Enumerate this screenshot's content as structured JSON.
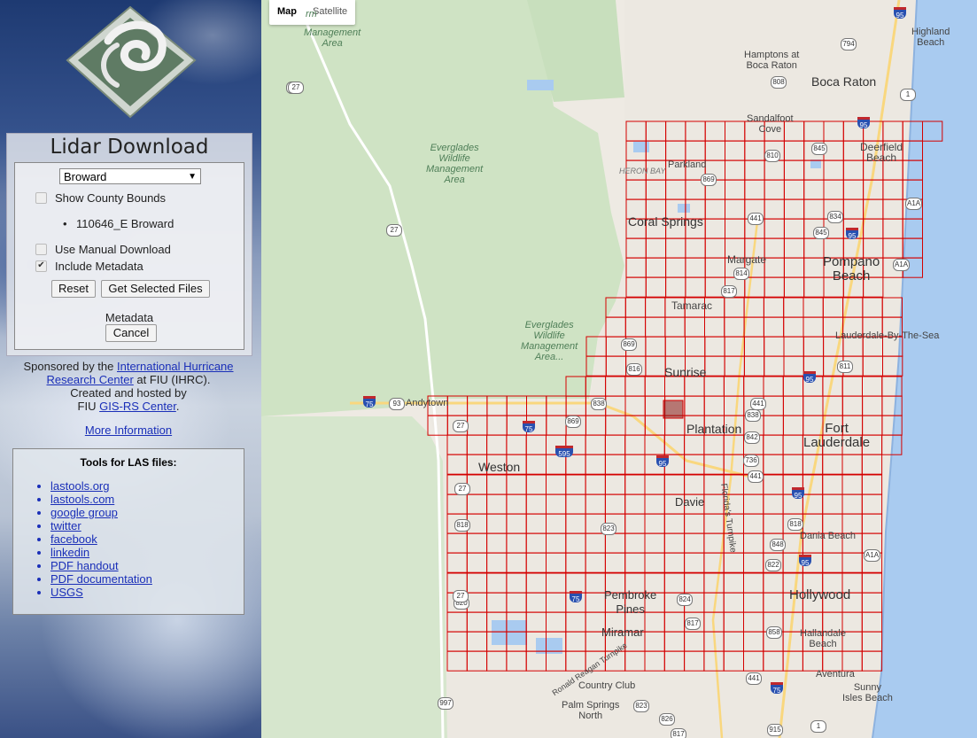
{
  "sidebar": {
    "title": "Lidar Download",
    "county_select": "Broward",
    "show_county_bounds": "Show County Bounds",
    "selected_tile": "110646_E Broward",
    "use_manual_download": "Use Manual Download",
    "include_metadata": "Include Metadata",
    "reset_label": "Reset",
    "get_files_label": "Get Selected Files",
    "metadata_label": "Metadata",
    "cancel_label": "Cancel",
    "sponsor": {
      "prefix": "Sponsored by the ",
      "ihrc_link": "International Hurricane Research Center",
      "mid": " at FIU (IHRC).",
      "created": "Created and hosted by",
      "fiu": "FIU ",
      "gis_link": "GIS-RS Center",
      "end": "."
    },
    "more_info": "More Information",
    "tools_title": "Tools for LAS files:",
    "tools": [
      "lastools.org",
      "lastools.com",
      "google group",
      "twitter",
      "facebook",
      "linkedin",
      "PDF handout",
      "PDF documentation",
      "USGS"
    ]
  },
  "map": {
    "toggle": {
      "map": "Map",
      "satellite": "Satellite"
    },
    "areas": {
      "wma_top": "Management\nArea",
      "wma_top_partial": "rm",
      "everglades1": "Everglades\nWildlife\nManagement\nArea",
      "everglades2": "Everglades\nWildlife\nManagement\nArea..."
    },
    "cities": {
      "hamptons": "Hamptons at\nBoca Raton",
      "boca": "Boca Raton",
      "highland": "Highland\nBeach",
      "sandalfoot": "Sandalfoot\nCove",
      "deerfield": "Deerfield\nBeach",
      "heron": "HERON BAY",
      "parkland": "Parkland",
      "coral": "Coral Springs",
      "margate": "Margate",
      "pompano": "Pompano\nBeach",
      "tamarac": "Tamarac",
      "lbts": "Lauderdale-By-The-Sea",
      "sunrise": "Sunrise",
      "andytown": "Andytown",
      "plantation": "Plantation",
      "fortl": "Fort\nLauderdale",
      "weston": "Weston",
      "davie": "Davie",
      "dania": "Dania Beach",
      "pembroke": "Pembroke\nPines",
      "hollywood": "Hollywood",
      "miramar": "Miramar",
      "hallandale": "Hallandale\nBeach",
      "aventura": "Aventura",
      "country": "Country Club",
      "palm": "Palm Springs\nNorth",
      "sunny": "Sunny\nIsles Beach",
      "florida_tpk": "Florida's Turnpike",
      "ronald": "Ronald Reagan Turnpike"
    },
    "shields": [
      "27",
      "794",
      "808",
      "1",
      "845",
      "810",
      "869",
      "441",
      "834",
      "845",
      "A1A",
      "814",
      "817",
      "A1A",
      "869",
      "816",
      "811",
      "838",
      "838",
      "441",
      "842",
      "736",
      "869",
      "441",
      "818",
      "823",
      "818",
      "848",
      "822",
      "A1A",
      "820",
      "858",
      "817",
      "824",
      "441",
      "997",
      "823",
      "826",
      "817",
      "915",
      "1",
      "93",
      "27",
      "27",
      "27",
      "27",
      "27"
    ],
    "interstates": [
      "95",
      "95",
      "95",
      "95",
      "95",
      "75",
      "75",
      "75",
      "595",
      "75",
      "95",
      "95"
    ]
  }
}
